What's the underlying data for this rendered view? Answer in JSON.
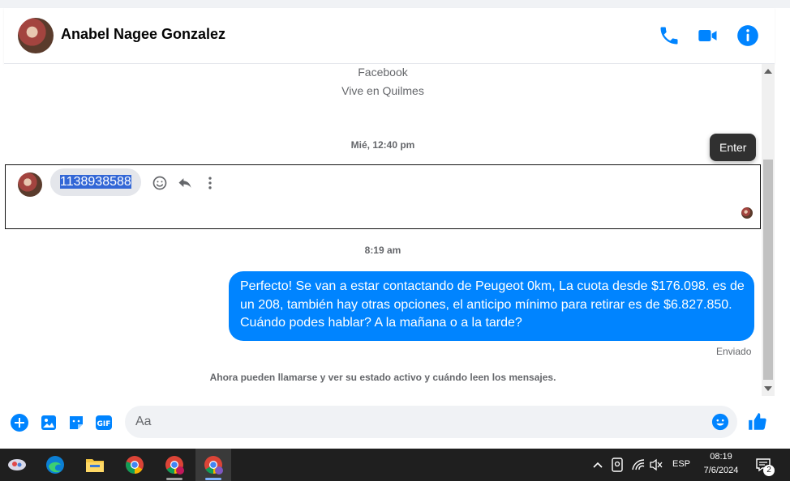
{
  "header": {
    "contact_name": "Anabel Nagee Gonzalez"
  },
  "chat": {
    "profile_source": "Facebook",
    "profile_location": "Vive en Quilmes",
    "timestamp_1": "Mié, 12:40 pm",
    "tooltip": "Enter",
    "incoming_message": "1138938588",
    "timestamp_2": "8:19 am",
    "outgoing_message": "Perfecto!  Se van a estar contactando de Peugeot 0km, La cuota desde $176.098. es de un 208, también hay otras opciones, el anticipo mínimo para retirar es de $6.827.850. Cuándo podes hablar? A la mañana o a la tarde?",
    "status": "Enviado",
    "notice": "Ahora pueden llamarse y ver su estado activo y cuándo leen los mensajes."
  },
  "composer": {
    "placeholder": "Aa"
  },
  "taskbar": {
    "language": "ESP",
    "time": "08:19",
    "date": "7/6/2024",
    "notification_count": "2"
  },
  "colors": {
    "accent": "#0084ff",
    "bubble_in": "#e4e6eb",
    "taskbar": "#1f1f1f"
  }
}
